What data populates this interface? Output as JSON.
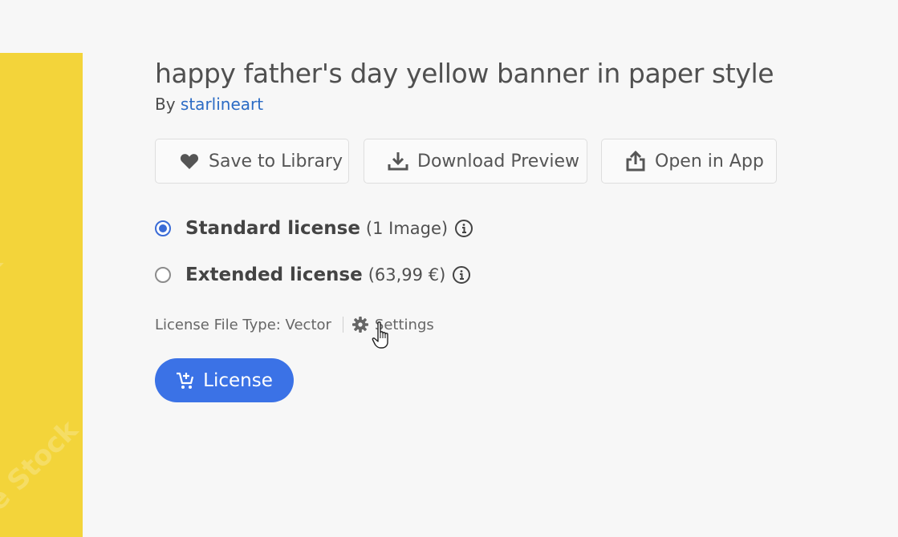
{
  "preview": {
    "watermark_texts": [
      "ck",
      "e Stock"
    ],
    "accent_color": "#f3d43a"
  },
  "asset": {
    "title": "happy father's day yellow banner in paper style",
    "by_prefix": "By",
    "author": "starlineart"
  },
  "actions": {
    "save_label": "Save to Library",
    "save_icon": "heart-icon",
    "download_label": "Download Preview",
    "download_icon": "download-icon",
    "open_label": "Open in App",
    "open_icon": "share-icon"
  },
  "licenses": [
    {
      "name": "Standard license",
      "detail": "(1 Image)",
      "selected": true
    },
    {
      "name": "Extended license",
      "detail": "(63,99 €)",
      "selected": false
    }
  ],
  "file_type": {
    "label": "License File Type: Vector",
    "settings_label": "Settings"
  },
  "license_button": {
    "label": "License",
    "color": "#3b72e6"
  }
}
